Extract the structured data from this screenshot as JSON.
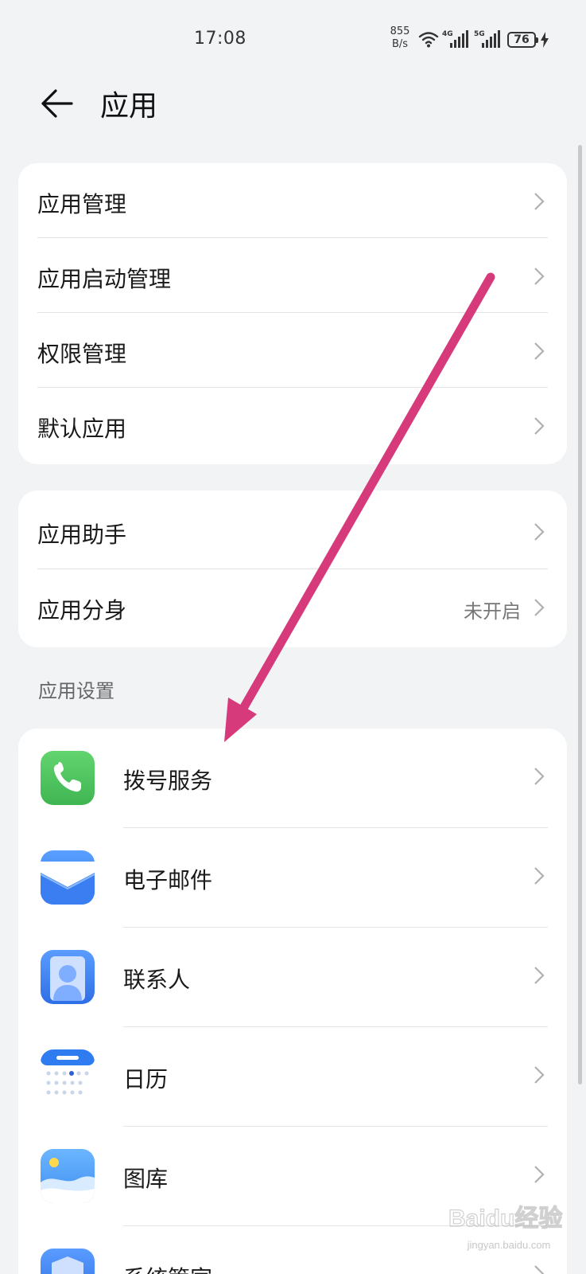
{
  "status_bar": {
    "time": "17:08",
    "net_speed_value": "855",
    "net_speed_unit": "B/s",
    "battery": "76",
    "sig1_tag": "4G",
    "sig2_tag": "5G"
  },
  "header": {
    "title": "应用"
  },
  "group1": {
    "items": [
      {
        "label": "应用管理"
      },
      {
        "label": "应用启动管理"
      },
      {
        "label": "权限管理"
      },
      {
        "label": "默认应用"
      }
    ]
  },
  "group2": {
    "items": [
      {
        "label": "应用助手",
        "value": ""
      },
      {
        "label": "应用分身",
        "value": "未开启"
      }
    ]
  },
  "section_label": "应用设置",
  "app_settings": {
    "items": [
      {
        "label": "拨号服务",
        "icon": "phone-icon",
        "color": "#4cc45e"
      },
      {
        "label": "电子邮件",
        "icon": "mail-icon",
        "color": "#3b82f0"
      },
      {
        "label": "联系人",
        "icon": "contacts-icon",
        "color": "#3b82f0"
      },
      {
        "label": "日历",
        "icon": "calendar-icon",
        "color": "#2f7cf0"
      },
      {
        "label": "图库",
        "icon": "gallery-icon",
        "color": "#4ea1f5"
      },
      {
        "label": "系统管家",
        "icon": "manager-icon",
        "color": "#3b82f0"
      }
    ]
  },
  "annotation": {
    "arrow_color": "#d63a7a"
  },
  "watermark": {
    "brand": "Baidu经验",
    "url": "jingyan.baidu.com"
  },
  "colors": {
    "background": "#f1f3f5",
    "card": "#ffffff",
    "chevron": "#b0b0b0"
  }
}
